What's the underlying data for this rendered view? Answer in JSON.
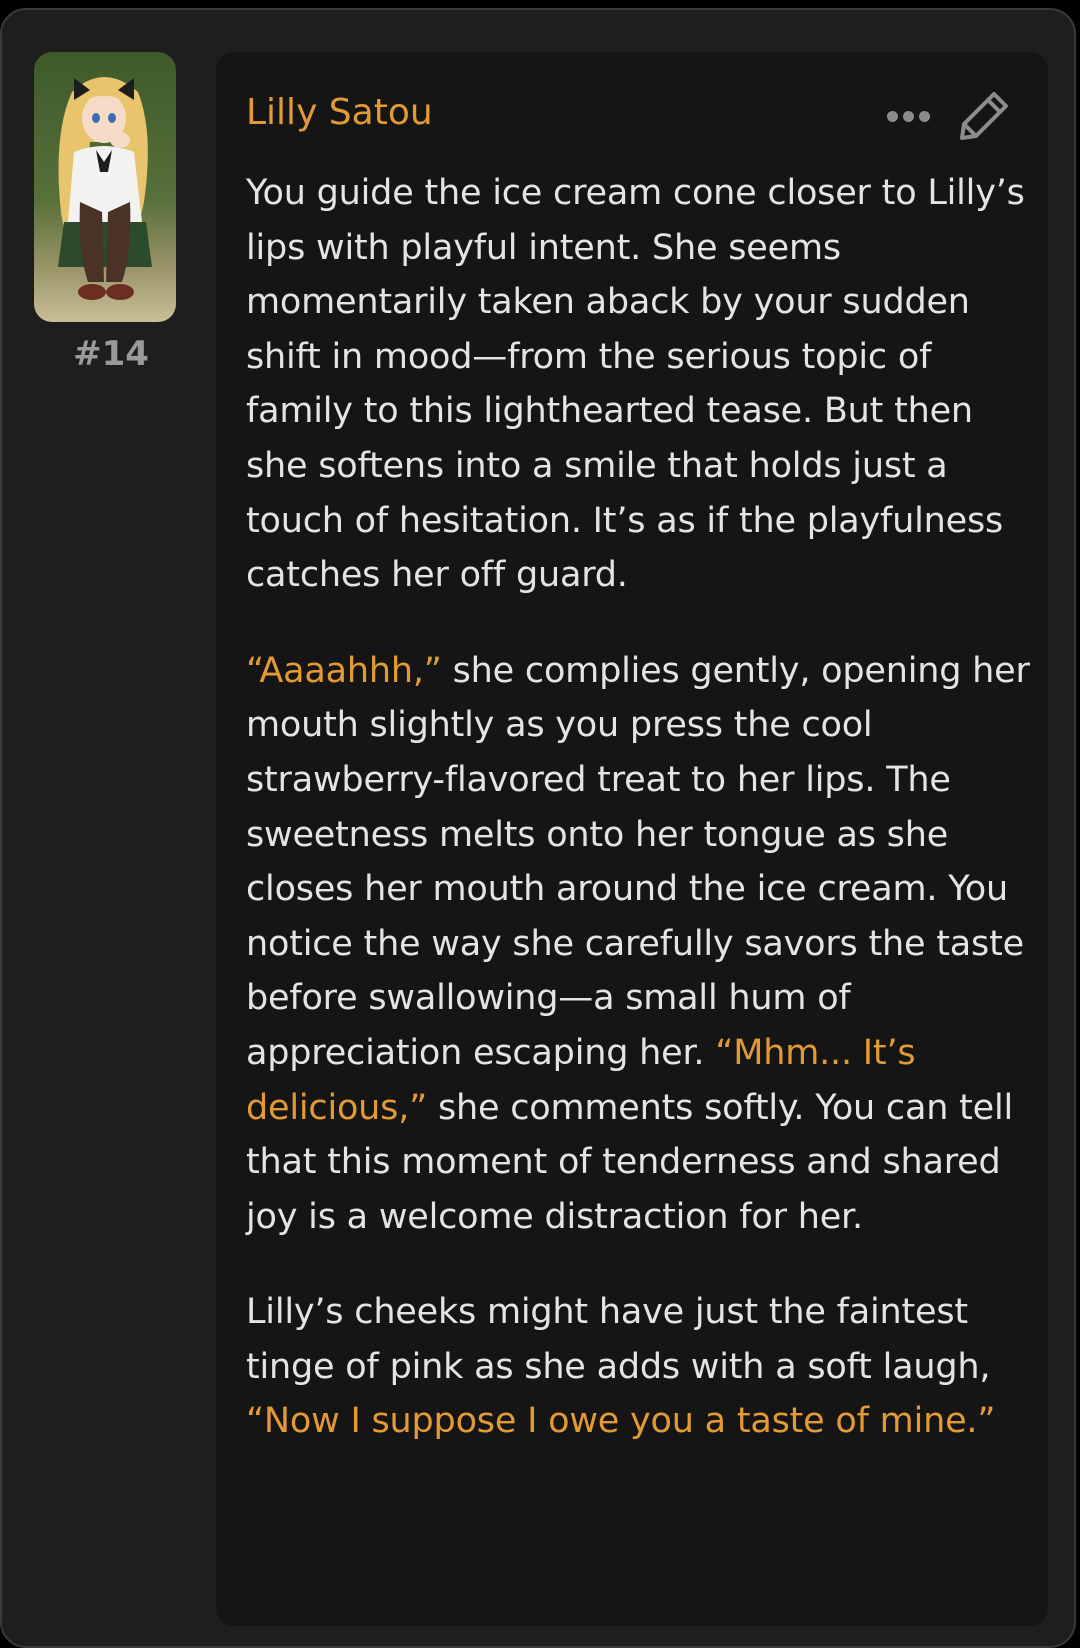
{
  "message": {
    "number": "#14",
    "character_name": "Lilly Satou",
    "accent_color": "#e39a35",
    "icons": {
      "more": "more-dots-icon",
      "edit": "pencil-icon"
    },
    "paragraphs": [
      [
        {
          "text": "You guide the ice cream cone closer to Lilly’s lips with playful intent. She seems momentarily taken aback by your sudden shift in mood—from the serious topic of family to this lighthearted tease. But then she softens into a smile that holds just a touch of hesitation. It’s as if the playfulness catches her off guard.",
          "quote": false
        }
      ],
      [
        {
          "text": "“Aaaahhh,”",
          "quote": true
        },
        {
          "text": " she complies gently, opening her mouth slightly as you press the cool strawberry-flavored treat to her lips. The sweetness melts onto her tongue as she closes her mouth around the ice cream. You notice the way she carefully savors the taste before swallowing—a small hum of appreciation escaping her. ",
          "quote": false
        },
        {
          "text": "“Mhm... It’s delicious,”",
          "quote": true
        },
        {
          "text": " she comments softly. You can tell that this moment of tenderness and shared joy is a welcome distraction for her.",
          "quote": false
        }
      ],
      [
        {
          "text": "Lilly’s cheeks might have just the faintest tinge of pink as she adds with a soft laugh, ",
          "quote": false
        },
        {
          "text": "“Now I suppose I owe you a taste of mine.”",
          "quote": true
        }
      ]
    ]
  }
}
